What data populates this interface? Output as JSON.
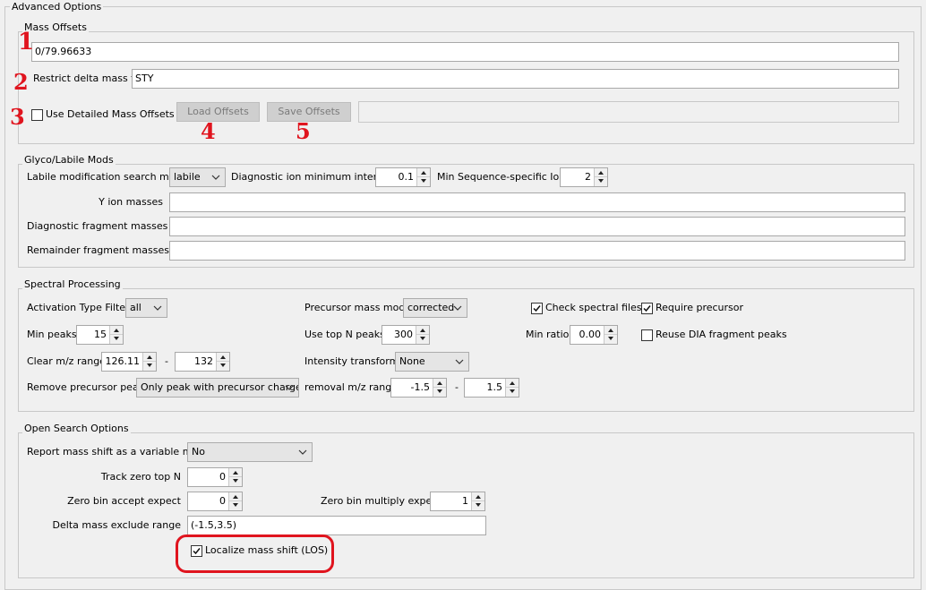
{
  "panel": {
    "title": "Advanced Options"
  },
  "mass_offsets": {
    "title": "Mass Offsets",
    "offsets_value": "0/79.96633",
    "restrict_label": "Restrict delta mass to",
    "restrict_value": "STY",
    "detailed_label": "Use Detailed Mass Offsets",
    "detailed_checked": false,
    "load_label": "Load Offsets",
    "save_label": "Save Offsets",
    "file_path": ""
  },
  "glyco": {
    "title": "Glyco/Labile Mods",
    "mode_label": "Labile modification search mode",
    "mode_value": "labile",
    "diag_min_label": "Diagnostic ion minimum intensity",
    "diag_min_value": "0.1",
    "min_seq_label": "Min Sequence-specific Ions",
    "min_seq_value": "2",
    "y_ion_label": "Y ion masses",
    "y_ion_value": "",
    "diag_frag_label": "Diagnostic fragment masses",
    "diag_frag_value": "",
    "remainder_label": "Remainder fragment masses",
    "remainder_value": ""
  },
  "spectral": {
    "title": "Spectral Processing",
    "activation_label": "Activation Type Filter",
    "activation_value": "all",
    "precursor_mode_label": "Precursor mass mode",
    "precursor_mode_value": "corrected",
    "check_files_label": "Check spectral files",
    "check_files_checked": true,
    "require_precursor_label": "Require precursor",
    "require_precursor_checked": true,
    "min_peaks_label": "Min peaks",
    "min_peaks_value": "15",
    "top_n_label": "Use top N peaks",
    "top_n_value": "300",
    "min_ratio_label": "Min ratio",
    "min_ratio_value": "0.00",
    "reuse_dia_label": "Reuse DIA fragment peaks",
    "reuse_dia_checked": false,
    "clear_mz_label": "Clear m/z range",
    "clear_mz_from": "126.11",
    "clear_mz_dash": "-",
    "clear_mz_to": "132",
    "intensity_label": "Intensity transform",
    "intensity_value": "None",
    "remove_peak_label": "Remove precursor peak",
    "remove_peak_value": "Only peak with precursor charge",
    "removal_range_label": "removal m/z range",
    "removal_from": "-1.5",
    "removal_dash": "-",
    "removal_to": "1.5"
  },
  "open_search": {
    "title": "Open Search Options",
    "report_label": "Report mass shift as a variable mod",
    "report_value": "No",
    "track_zero_label": "Track zero top N",
    "track_zero_value": "0",
    "zero_accept_label": "Zero bin accept expect",
    "zero_accept_value": "0",
    "zero_multiply_label": "Zero bin multiply expect",
    "zero_multiply_value": "1",
    "delta_exclude_label": "Delta mass exclude range",
    "delta_exclude_value": "(-1.5,3.5)",
    "localize_label": "Localize mass shift (LOS)",
    "localize_checked": true
  },
  "annotations": {
    "n1": "1",
    "n2": "2",
    "n3": "3",
    "n4": "4",
    "n5": "5",
    "color": "#e0141e"
  }
}
